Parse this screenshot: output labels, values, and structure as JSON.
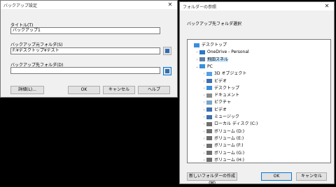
{
  "left_dialog": {
    "title": "バックアップ設定",
    "title_label": "タイトル(T)",
    "title_value": "バックアップ1",
    "source_label": "バックアップ元フォルダ(S)",
    "source_value": "F:¥デスクトップ¥テスト",
    "dest_label": "バックアップ先フォルダ(D)",
    "dest_value": "",
    "buttons": {
      "details": "詳細(L)...",
      "ok": "OK",
      "cancel": "キャンセル",
      "help": "ヘルプ"
    }
  },
  "folder_dialog": {
    "title": "フォルダーの参照",
    "prompt": "バックアップ先フォルダ選択",
    "tree": [
      {
        "label": "デスクトップ",
        "arrow": "",
        "icon": "desktop-folder-icon",
        "color": "#3b8edb"
      },
      {
        "label": "OneDrive - Personal",
        "arrow": "›",
        "icon": "cloud-icon",
        "color": "#2b78c5"
      },
      {
        "label": "飛田スネル",
        "arrow": "›",
        "icon": "user-icon",
        "color": "#5a7fa8",
        "selected": true
      },
      {
        "label": "PC",
        "arrow": "⌄",
        "icon": "computer-icon",
        "color": "#3b8edb"
      },
      {
        "label": "3D オブジェクト",
        "arrow": "›",
        "icon": "3d-objects-icon",
        "color": "#57a0e5"
      },
      {
        "label": "ビデオ",
        "arrow": "›",
        "icon": "video-icon",
        "color": "#3d6fb5"
      },
      {
        "label": "デスクトップ",
        "arrow": "›",
        "icon": "desktop-folder-icon",
        "color": "#3b8edb"
      },
      {
        "label": "ドキュメント",
        "arrow": "›",
        "icon": "documents-icon",
        "color": "#8a8a8a"
      },
      {
        "label": "ピクチャ",
        "arrow": "›",
        "icon": "pictures-icon",
        "color": "#7aa6c9"
      },
      {
        "label": "ビデオ",
        "arrow": "›",
        "icon": "video-icon",
        "color": "#3d6fb5"
      },
      {
        "label": "ミュージック",
        "arrow": "›",
        "icon": "music-icon",
        "color": "#3b6fb0"
      },
      {
        "label": "ローカル ディスク (C:)",
        "arrow": "›",
        "icon": "drive-icon",
        "color": "#6f6f6f"
      },
      {
        "label": "ボリューム (D:)",
        "arrow": "›",
        "icon": "drive-icon",
        "color": "#6f6f6f"
      },
      {
        "label": "ボリューム (E:)",
        "arrow": "›",
        "icon": "drive-icon",
        "color": "#6f6f6f"
      },
      {
        "label": "ボリューム (F:)",
        "arrow": "›",
        "icon": "drive-icon",
        "color": "#6f6f6f"
      },
      {
        "label": "ボリューム (G:)",
        "arrow": "›",
        "icon": "drive-icon",
        "color": "#6f6f6f"
      },
      {
        "label": "ボリューム (H:)",
        "arrow": "›",
        "icon": "drive-icon",
        "color": "#6f6f6f"
      }
    ],
    "buttons": {
      "new_folder": "新しいフォルダーの作成(M)",
      "ok": "OK",
      "cancel": "キャンセル"
    }
  }
}
